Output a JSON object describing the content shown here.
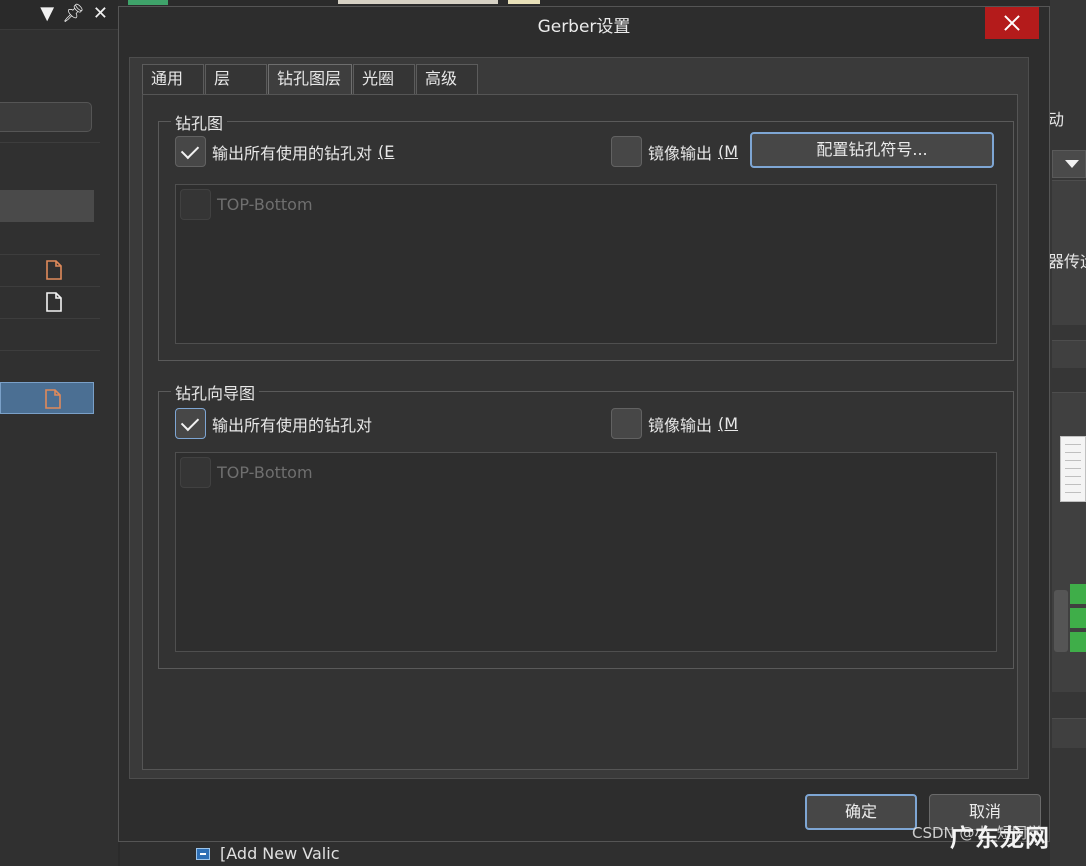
{
  "app": {
    "watermark_brand": "广东龙网",
    "watermark_source": "CSDN @小_短同学",
    "bottom_item": "[Add New Valic"
  },
  "right_panel": {
    "label_1": "动",
    "label_2": "器传运"
  },
  "dialog": {
    "title": "Gerber设置",
    "tabs": [
      {
        "label": "通用"
      },
      {
        "label": "层"
      },
      {
        "label": "钻孔图层"
      },
      {
        "label": "光圈"
      },
      {
        "label": "高级"
      }
    ],
    "active_tab": "钻孔图层",
    "drill_drawing": {
      "title": "钻孔图",
      "output_all_label": "输出所有使用的钻孔对",
      "output_all_suffix": "(E",
      "output_all_checked": true,
      "mirror_label": "镜像输出",
      "mirror_suffix": "(M",
      "mirror_checked": false,
      "config_button": "配置钻孔符号...",
      "list": [
        "TOP-Bottom"
      ]
    },
    "drill_guide": {
      "title": "钻孔向导图",
      "output_all_label": "输出所有使用的钻孔对",
      "output_all_checked": true,
      "mirror_label": "镜像输出",
      "mirror_suffix": "(M",
      "mirror_checked": false,
      "list": [
        "TOP-Bottom"
      ]
    },
    "ok_label": "确定",
    "cancel_label": "取消"
  },
  "colors": {
    "close_red": "#b41b1b",
    "focus_blue": "#7ea6d4",
    "selection_blue": "#4b6f93"
  }
}
